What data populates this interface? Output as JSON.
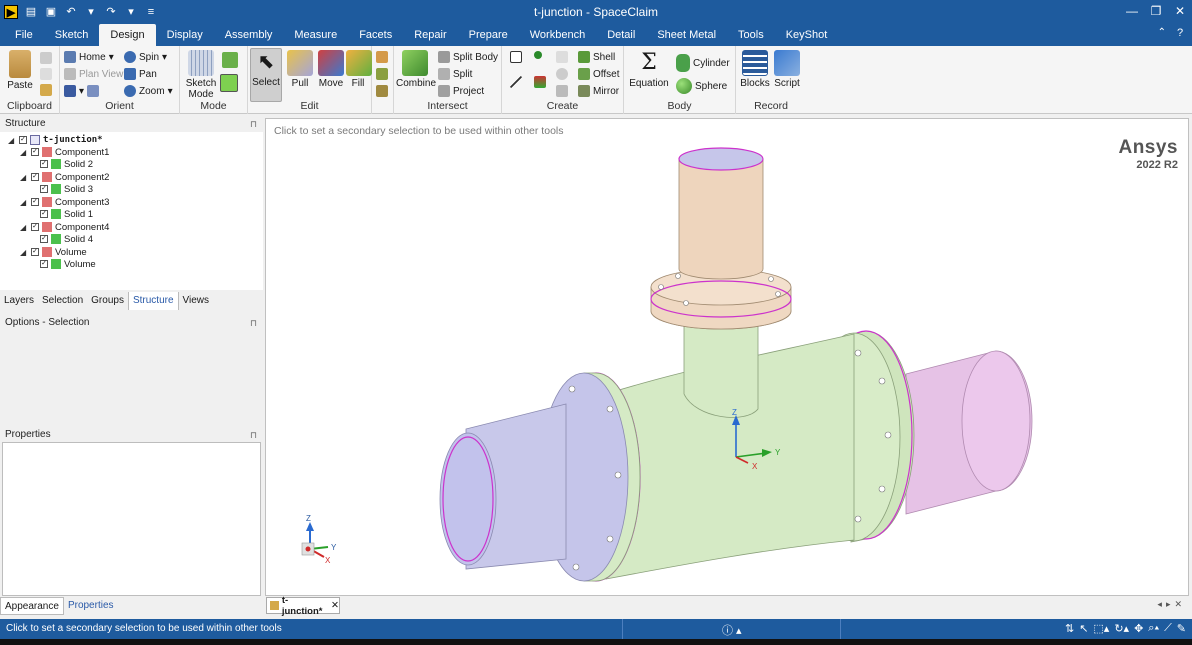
{
  "window": {
    "title": "t-junction - SpaceClaim"
  },
  "menu_tabs": [
    "File",
    "Sketch",
    "Design",
    "Display",
    "Assembly",
    "Measure",
    "Facets",
    "Repair",
    "Prepare",
    "Workbench",
    "Detail",
    "Sheet Metal",
    "Tools",
    "KeyShot"
  ],
  "active_tab": "Design",
  "ribbon": {
    "clipboard": {
      "label": "Clipboard",
      "paste": "Paste"
    },
    "orient": {
      "label": "Orient",
      "home": "Home",
      "plan_view": "Plan View",
      "spin": "Spin",
      "pan": "Pan",
      "zoom": "Zoom"
    },
    "mode": {
      "label": "Mode",
      "sketch_mode": "Sketch Mode"
    },
    "edit": {
      "label": "Edit",
      "select": "Select",
      "pull": "Pull",
      "move": "Move",
      "fill": "Fill"
    },
    "intersect": {
      "label": "Intersect",
      "combine": "Combine",
      "split_body": "Split Body",
      "split": "Split",
      "project": "Project"
    },
    "create": {
      "label": "Create",
      "shell": "Shell",
      "offset": "Offset",
      "mirror": "Mirror"
    },
    "body": {
      "label": "Body",
      "equation": "Equation",
      "cylinder": "Cylinder",
      "sphere": "Sphere"
    },
    "record": {
      "label": "Record",
      "blocks": "Blocks",
      "script": "Script"
    }
  },
  "structure_panel": {
    "title": "Structure",
    "tree": [
      {
        "label": "t-junction*",
        "level": 0,
        "kind": "root"
      },
      {
        "label": "Component1",
        "level": 1,
        "kind": "component"
      },
      {
        "label": "Solid 2",
        "level": 2,
        "kind": "solid"
      },
      {
        "label": "Component2",
        "level": 1,
        "kind": "component"
      },
      {
        "label": "Solid 3",
        "level": 2,
        "kind": "solid"
      },
      {
        "label": "Component3",
        "level": 1,
        "kind": "component"
      },
      {
        "label": "Solid 1",
        "level": 2,
        "kind": "solid"
      },
      {
        "label": "Component4",
        "level": 1,
        "kind": "component"
      },
      {
        "label": "Solid 4",
        "level": 2,
        "kind": "solid"
      },
      {
        "label": "Volume",
        "level": 1,
        "kind": "component"
      },
      {
        "label": "Volume",
        "level": 2,
        "kind": "solid"
      }
    ]
  },
  "left_tabs": [
    "Layers",
    "Selection",
    "Groups",
    "Structure",
    "Views"
  ],
  "left_tabs_active": "Structure",
  "options_panel": {
    "title": "Options - Selection"
  },
  "properties_panel": {
    "title": "Properties"
  },
  "bottom_tabs": [
    "Appearance",
    "Properties"
  ],
  "viewport": {
    "hint": "Click to set a secondary selection to be used within other tools",
    "brand": "Ansys",
    "version": "2022 R2",
    "triad_labels": {
      "x": "X",
      "y": "Y",
      "z": "Z"
    }
  },
  "doc_tab": {
    "label": "t-junction*"
  },
  "status": {
    "message": "Click to set a secondary selection to be used within other tools"
  },
  "colors": {
    "titlebar": "#1e5b9e",
    "pipe_left": "#c5c5ea",
    "pipe_right": "#e8c3e8",
    "pipe_main": "#d8ecc8",
    "pipe_top": "#efd8c0",
    "edge_highlight": "#cc33cc"
  }
}
